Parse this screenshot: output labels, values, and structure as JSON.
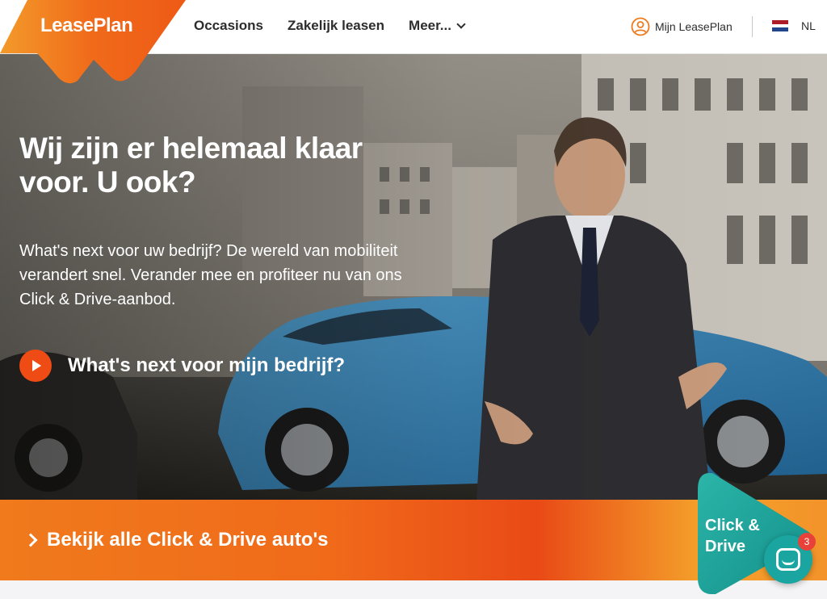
{
  "brand": {
    "logo_text": "LeasePlan",
    "accent": "#ee4c14",
    "teal": "#1aa5a0"
  },
  "nav": {
    "items": [
      {
        "label": "Occasions"
      },
      {
        "label": "Zakelijk leasen"
      },
      {
        "label": "Meer..."
      }
    ],
    "account_label": "Mijn LeasePlan",
    "language": "NL"
  },
  "hero": {
    "title": "Wij zijn er helemaal klaar voor. U ook?",
    "text": "What's next voor uw bedrijf? De wereld van mobiliteit verandert snel. Verander mee en profiteer nu van ons Click & Drive-aanbod.",
    "video_link": "What's next voor mijn bedrijf?"
  },
  "band": {
    "link_label": "Bekijk alle Click & Drive auto's"
  },
  "badge": {
    "line1": "Click &",
    "line2": "Drive"
  },
  "chat": {
    "unread_count": "3"
  }
}
